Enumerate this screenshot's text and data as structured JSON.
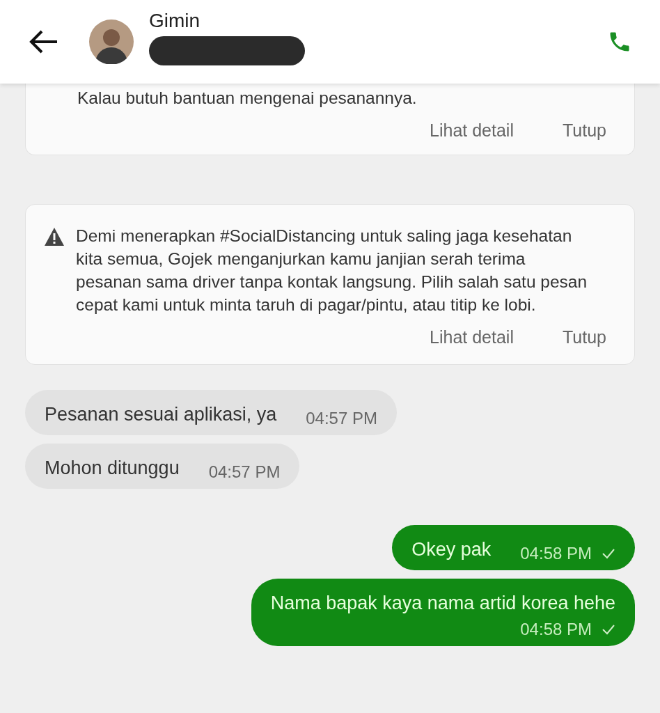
{
  "header": {
    "contact_name": "Gimin",
    "redacted": true
  },
  "notices": [
    {
      "text": "Kalau butuh bantuan mengenai pesanannya.",
      "warning": false,
      "actions": [
        "Lihat detail",
        "Tutup"
      ]
    },
    {
      "text": "Demi menerapkan #SocialDistancing untuk saling jaga kesehatan kita semua, Gojek menganjurkan kamu janjian serah terima pesanan sama driver tanpa kontak langsung. Pilih salah satu pesan cepat kami untuk minta taruh di pagar/pintu, atau titip ke lobi.",
      "warning": true,
      "actions": [
        "Lihat detail",
        "Tutup"
      ]
    }
  ],
  "messages": [
    {
      "kind": "incoming",
      "text": "Pesanan sesuai aplikasi, ya",
      "time": "04:57 PM",
      "ticked": false
    },
    {
      "kind": "incoming",
      "text": "Mohon ditunggu",
      "time": "04:57 PM",
      "ticked": false
    },
    {
      "kind": "outgoing",
      "text": "Okey pak",
      "time": "04:58 PM",
      "ticked": true
    },
    {
      "kind": "outgoing",
      "text": "Nama bapak kaya nama artid korea hehe",
      "time": "04:58 PM",
      "ticked": true
    }
  ]
}
